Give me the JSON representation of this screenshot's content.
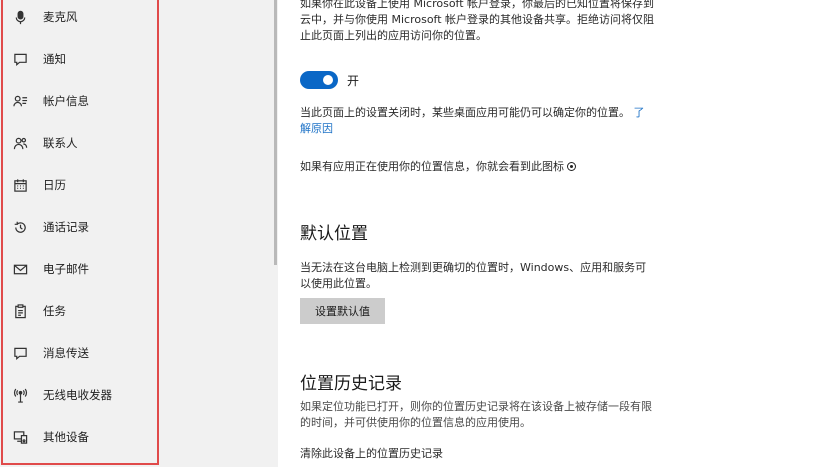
{
  "sidebar": {
    "items": [
      {
        "label": "麦克风",
        "icon": "microphone-icon"
      },
      {
        "label": "通知",
        "icon": "notification-icon"
      },
      {
        "label": "帐户信息",
        "icon": "account-info-icon"
      },
      {
        "label": "联系人",
        "icon": "contacts-icon"
      },
      {
        "label": "日历",
        "icon": "calendar-icon"
      },
      {
        "label": "通话记录",
        "icon": "call-history-icon"
      },
      {
        "label": "电子邮件",
        "icon": "email-icon"
      },
      {
        "label": "任务",
        "icon": "tasks-icon"
      },
      {
        "label": "消息传送",
        "icon": "messaging-icon"
      },
      {
        "label": "无线电收发器",
        "icon": "radio-icon"
      },
      {
        "label": "其他设备",
        "icon": "other-devices-icon"
      }
    ]
  },
  "main": {
    "intro_line1": "如果你在此设备上使用 Microsoft 帐户登录，你最后的已知位置将保存到",
    "intro_line2": "云中，并与你使用 Microsoft 帐户登录的其他设备共享。拒绝访问将仅阻",
    "intro_line3": "止此页面上列出的应用访问你的位置。",
    "toggle_label": "开",
    "toggle_on": true,
    "note_line1": "当此页面上的设置关闭时，某些桌面应用可能仍可以确定你的位置。",
    "note_link_part1": "了",
    "note_link_part2": "解原因",
    "icon_note": "如果有应用正在使用你的位置信息，你就会看到此图标",
    "default_location_heading": "默认位置",
    "default_location_line1": "当无法在这台电脑上检测到更确切的位置时，Windows、应用和服务可",
    "default_location_line2": "以使用此位置。",
    "set_default_button": "设置默认值",
    "history_heading": "位置历史记录",
    "history_line1": "如果定位功能已打开，则你的位置历史记录将在该设备上被存储一段有限",
    "history_line2": "的时间，并可供使用你的位置信息的应用使用。",
    "clear_history_label": "清除此设备上的位置历史记录"
  },
  "colors": {
    "accent": "#0a67c6",
    "link": "#1d72c7",
    "highlight_border": "#e04a4a",
    "sidebar_bg": "#f1f1f1"
  }
}
